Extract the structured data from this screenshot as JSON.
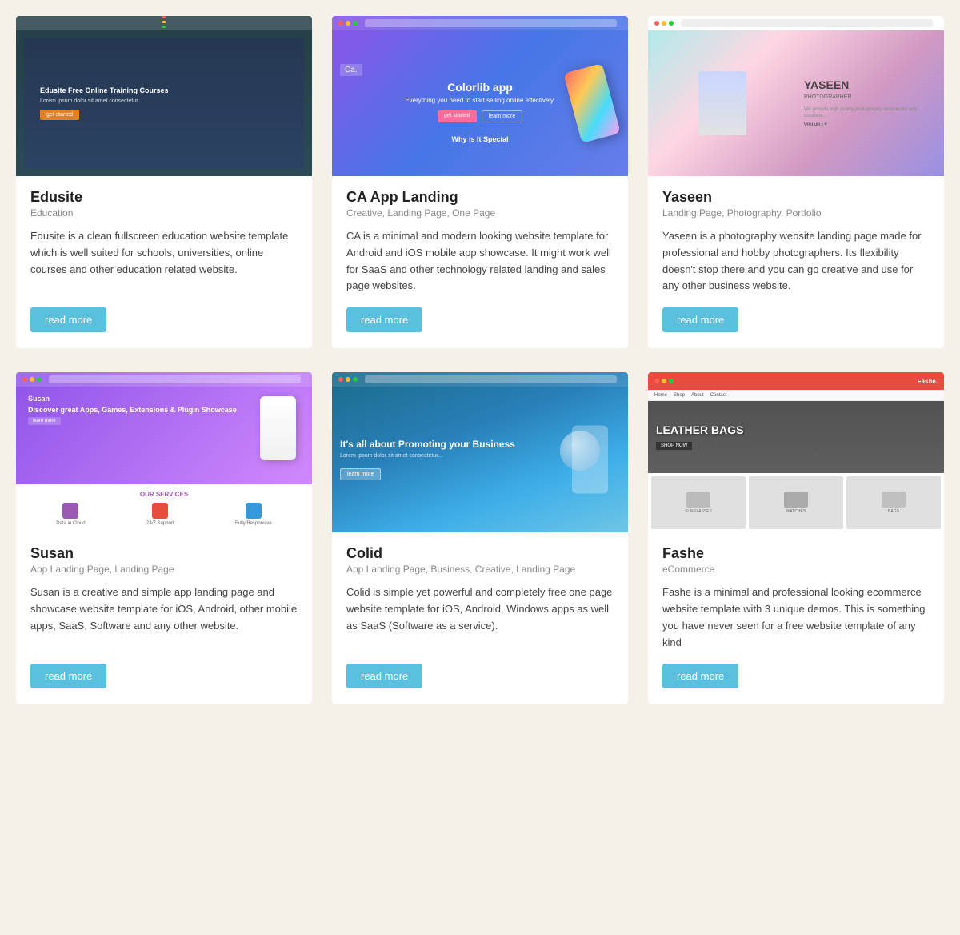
{
  "cards": [
    {
      "id": "edusite",
      "title": "Edusite",
      "tags": "Education",
      "description": "Edusite is a clean fullscreen education website template which is well suited for schools, universities, online courses and other education related website.",
      "read_more": "read more",
      "mock_type": "edusite"
    },
    {
      "id": "ca-app",
      "title": "CA App Landing",
      "tags": "Creative, Landing Page, One Page",
      "description": "CA is a minimal and modern looking website template for Android and iOS mobile app showcase. It might work well for SaaS and other technology related landing and sales page websites.",
      "read_more": "read more",
      "mock_type": "ca"
    },
    {
      "id": "yaseen",
      "title": "Yaseen",
      "tags": "Landing Page, Photography, Portfolio",
      "description": "Yaseen is a photography website landing page made for professional and hobby photographers. Its flexibility doesn't stop there and you can go creative and use for any other business website.",
      "read_more": "read more",
      "mock_type": "yaseen"
    },
    {
      "id": "susan",
      "title": "Susan",
      "tags": "App Landing Page, Landing Page",
      "description": "Susan is a creative and simple app landing page and showcase website template for iOS, Android, other mobile apps, SaaS, Software and any other website.",
      "read_more": "read more",
      "mock_type": "susan"
    },
    {
      "id": "colid",
      "title": "Colid",
      "tags": "App Landing Page, Business, Creative, Landing Page",
      "description": "Colid is simple yet powerful and completely free one page website template for iOS, Android, Windows apps as well as SaaS (Software as a service).",
      "read_more": "read more",
      "mock_type": "colid"
    },
    {
      "id": "fashe",
      "title": "Fashe",
      "tags": "eCommerce",
      "description": "Fashe is a minimal and professional looking ecommerce website template with 3 unique demos. This is something you have never seen for a free website template of any kind",
      "read_more": "read more",
      "mock_type": "fashe"
    }
  ],
  "ui": {
    "read_more_label": "read more"
  }
}
